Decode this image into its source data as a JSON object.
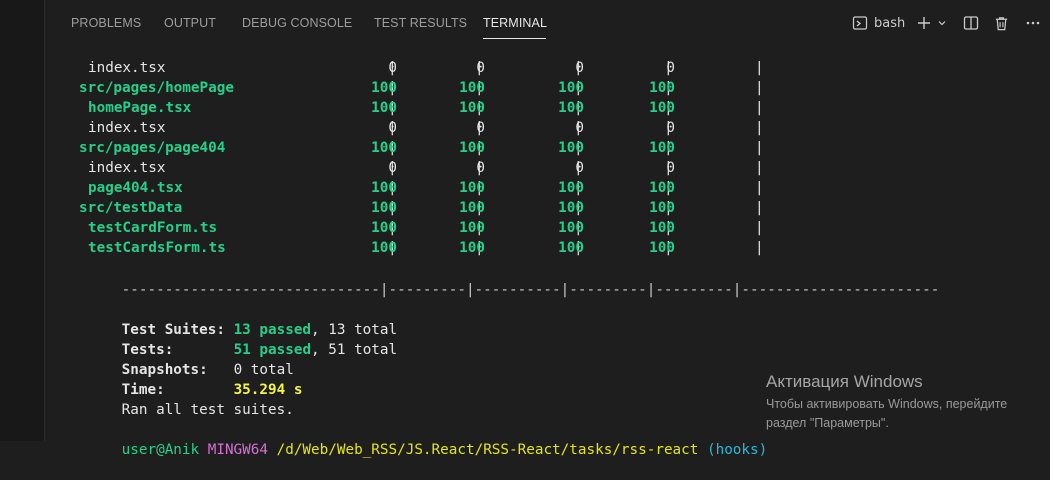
{
  "tabs": [
    {
      "label": "PROBLEMS"
    },
    {
      "label": "OUTPUT"
    },
    {
      "label": "DEBUG CONSOLE"
    },
    {
      "label": "TEST RESULTS"
    },
    {
      "label": "TERMINAL",
      "active": true
    }
  ],
  "toolbar": {
    "shell_label": "bash",
    "icons": [
      "terminal-icon",
      "plus-icon",
      "chevron-down-icon",
      "split-icon",
      "trash-icon",
      "ellipsis-icon"
    ]
  },
  "coverage": {
    "rows": [
      {
        "name": "index.tsx",
        "indent": true,
        "color": "white",
        "values": [
          "0",
          "0",
          "0",
          "0"
        ]
      },
      {
        "name": "src/pages/homePage",
        "indent": false,
        "color": "green",
        "values": [
          "100",
          "100",
          "100",
          "100"
        ]
      },
      {
        "name": "homePage.tsx",
        "indent": true,
        "color": "green",
        "values": [
          "100",
          "100",
          "100",
          "100"
        ]
      },
      {
        "name": "index.tsx",
        "indent": true,
        "color": "white",
        "values": [
          "0",
          "0",
          "0",
          "0"
        ]
      },
      {
        "name": "src/pages/page404",
        "indent": false,
        "color": "green",
        "values": [
          "100",
          "100",
          "100",
          "100"
        ]
      },
      {
        "name": "index.tsx",
        "indent": true,
        "color": "white",
        "values": [
          "0",
          "0",
          "0",
          "0"
        ]
      },
      {
        "name": "page404.tsx",
        "indent": true,
        "color": "green",
        "values": [
          "100",
          "100",
          "100",
          "100"
        ]
      },
      {
        "name": "src/testData",
        "indent": false,
        "color": "green",
        "values": [
          "100",
          "100",
          "100",
          "100"
        ]
      },
      {
        "name": "testCardForm.ts",
        "indent": true,
        "color": "green",
        "values": [
          "100",
          "100",
          "100",
          "100"
        ]
      },
      {
        "name": "testCardsForm.ts",
        "indent": true,
        "color": "green",
        "values": [
          "100",
          "100",
          "100",
          "100"
        ]
      }
    ],
    "separator": "------------------------------|---------|----------|---------|---------|-----------------------"
  },
  "summary": {
    "suites_label": "Test Suites:",
    "suites_passed": "13 passed",
    "suites_total": ", 13 total",
    "tests_label": "Tests:",
    "tests_passed": "51 passed",
    "tests_total": ", 51 total",
    "snapshots_label": "Snapshots:",
    "snapshots_value": "0 total",
    "time_label": "Time:",
    "time_value": "35.294 s",
    "ran": "Ran all test suites."
  },
  "prompt": {
    "user": "user@Anik",
    "system": "MINGW64",
    "path": "/d/Web/Web_RSS/JS.React/RSS-React/tasks/rss-react",
    "branch": "(hooks)"
  },
  "watermark": {
    "title": "Активация Windows",
    "line1": "Чтобы активировать Windows, перейдите",
    "line2": "раздел \"Параметры\"."
  },
  "colors": {
    "background": "#1e1e1e",
    "green": "#23d18b",
    "yellow": "#f5f543",
    "magenta": "#d670d6",
    "cyan": "#29b8db",
    "text": "#cccccc"
  }
}
